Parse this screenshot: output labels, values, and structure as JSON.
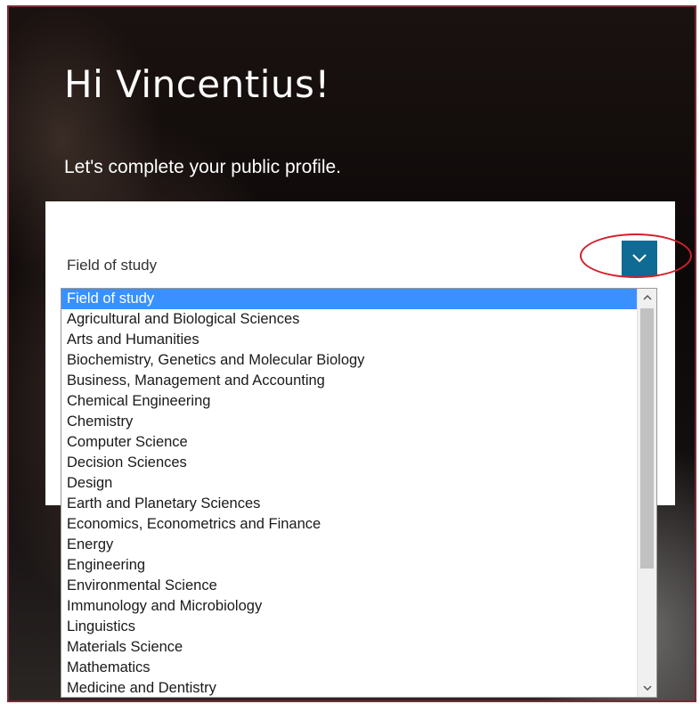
{
  "greeting": "Hi Vincentius!",
  "subtitle": "Let's complete your public profile.",
  "field_select": {
    "label": "Field of study",
    "toggle_color": "#0f6a94",
    "selected_value": "Field of study",
    "options": [
      "Field of study",
      "Agricultural and Biological Sciences",
      "Arts and Humanities",
      "Biochemistry, Genetics and Molecular Biology",
      "Business, Management and Accounting",
      "Chemical Engineering",
      "Chemistry",
      "Computer Science",
      "Decision Sciences",
      "Design",
      "Earth and Planetary Sciences",
      "Economics, Econometrics and Finance",
      "Energy",
      "Engineering",
      "Environmental Science",
      "Immunology and Microbiology",
      "Linguistics",
      "Materials Science",
      "Mathematics",
      "Medicine and Dentistry"
    ]
  },
  "colors": {
    "selected_option_bg": "#3b90ff",
    "annotation_circle": "#d4202a",
    "frame_border": "#7a2a36"
  }
}
